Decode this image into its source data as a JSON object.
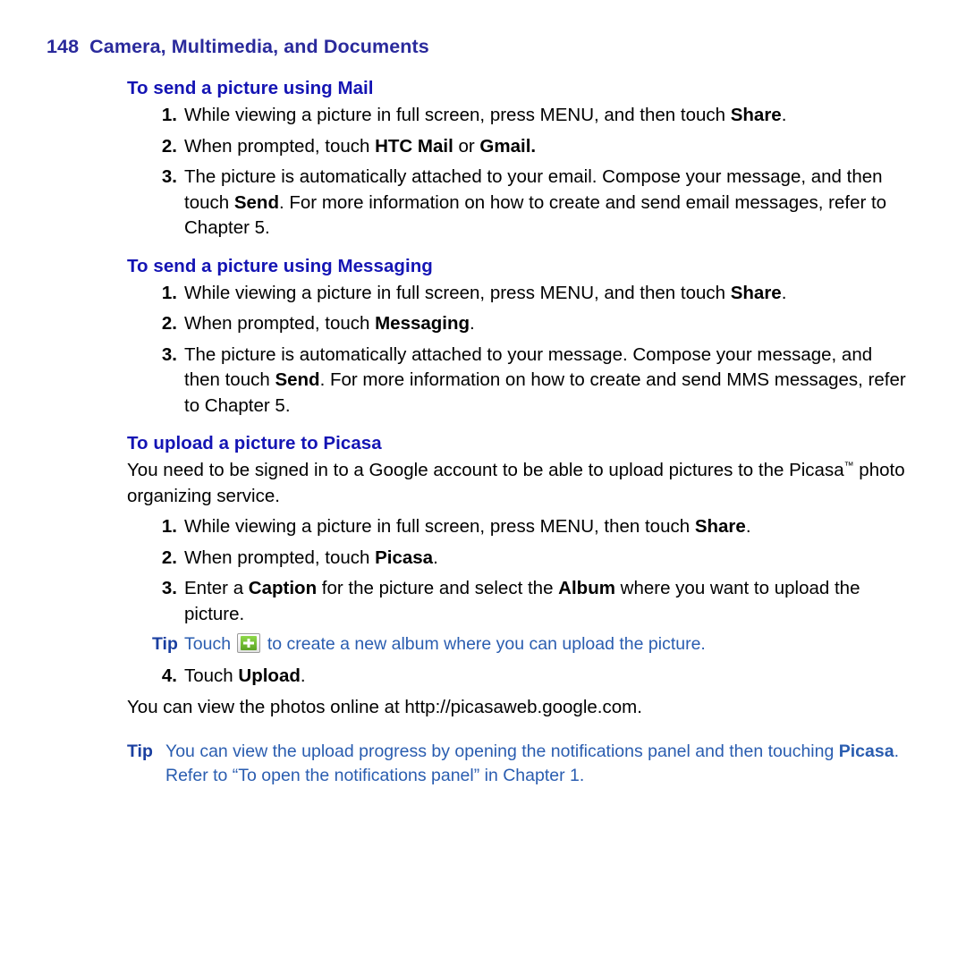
{
  "page": {
    "number": "148",
    "running_head": "Camera, Multimedia, and Documents"
  },
  "sections": [
    {
      "heading": "To send a picture using Mail",
      "steps": [
        {
          "num": "1.",
          "parts": [
            {
              "t": "While viewing a picture in full screen, press MENU, and then touch ",
              "b": false
            },
            {
              "t": "Share",
              "b": true
            },
            {
              "t": ".",
              "b": false
            }
          ]
        },
        {
          "num": "2.",
          "parts": [
            {
              "t": "When prompted, touch ",
              "b": false
            },
            {
              "t": "HTC Mail",
              "b": true
            },
            {
              "t": " or ",
              "b": false
            },
            {
              "t": "Gmail.",
              "b": true
            }
          ]
        },
        {
          "num": "3.",
          "parts": [
            {
              "t": "The picture is automatically attached to your email. Compose your message, and then touch ",
              "b": false
            },
            {
              "t": "Send",
              "b": true
            },
            {
              "t": ". For more information on how to create and send email messages, refer to Chapter 5.",
              "b": false
            }
          ]
        }
      ]
    },
    {
      "heading": "To send a picture using Messaging",
      "steps": [
        {
          "num": "1.",
          "parts": [
            {
              "t": "While viewing a picture in full screen, press MENU, and then touch ",
              "b": false
            },
            {
              "t": "Share",
              "b": true
            },
            {
              "t": ".",
              "b": false
            }
          ]
        },
        {
          "num": "2.",
          "parts": [
            {
              "t": "When prompted, touch ",
              "b": false
            },
            {
              "t": "Messaging",
              "b": true
            },
            {
              "t": ".",
              "b": false
            }
          ]
        },
        {
          "num": "3.",
          "parts": [
            {
              "t": "The picture is automatically attached to your message. Compose your message, and then touch ",
              "b": false
            },
            {
              "t": "Send",
              "b": true
            },
            {
              "t": ". For more information on how to create and send MMS messages, refer to Chapter 5.",
              "b": false
            }
          ]
        }
      ]
    },
    {
      "heading": "To upload a picture to Picasa",
      "intro": [
        {
          "t": "You need to be signed in to a Google account to be able to upload pictures to the Picasa",
          "b": false
        },
        {
          "t": "™",
          "b": false,
          "sup": true
        },
        {
          "t": " photo organizing service.",
          "b": false
        }
      ],
      "steps": [
        {
          "num": "1.",
          "parts": [
            {
              "t": "While viewing a picture in full screen, press MENU, then touch ",
              "b": false
            },
            {
              "t": "Share",
              "b": true
            },
            {
              "t": ".",
              "b": false
            }
          ]
        },
        {
          "num": "2.",
          "parts": [
            {
              "t": "When prompted, touch ",
              "b": false
            },
            {
              "t": "Picasa",
              "b": true
            },
            {
              "t": ".",
              "b": false
            }
          ]
        },
        {
          "num": "3.",
          "parts": [
            {
              "t": "Enter a ",
              "b": false
            },
            {
              "t": "Caption",
              "b": true
            },
            {
              "t": " for the picture and select the ",
              "b": false
            },
            {
              "t": "Album",
              "b": true
            },
            {
              "t": " where you want to upload the picture.",
              "b": false
            }
          ]
        },
        {
          "num": "4.",
          "parts": [
            {
              "t": "Touch ",
              "b": false
            },
            {
              "t": "Upload",
              "b": true
            },
            {
              "t": ".",
              "b": false
            }
          ]
        }
      ]
    }
  ],
  "tips": {
    "label": "Tip",
    "inline_tip": {
      "before": "Touch ",
      "icon": "add-plus-icon",
      "after": " to create a new album where you can upload the picture."
    },
    "closing_tip": [
      {
        "t": "You can view the upload progress by opening the notifications panel and then touching ",
        "b": false
      },
      {
        "t": "Picasa",
        "b": true
      },
      {
        "t": ". Refer to “To open the notifications panel” in Chapter 1.",
        "b": false
      }
    ]
  },
  "closing_line": "You can view the photos online at http://picasaweb.google.com.",
  "colors": {
    "heading_blue": "#1414b4",
    "running_head_blue": "#2a2a9c",
    "tip_blue": "#2a5db0"
  }
}
